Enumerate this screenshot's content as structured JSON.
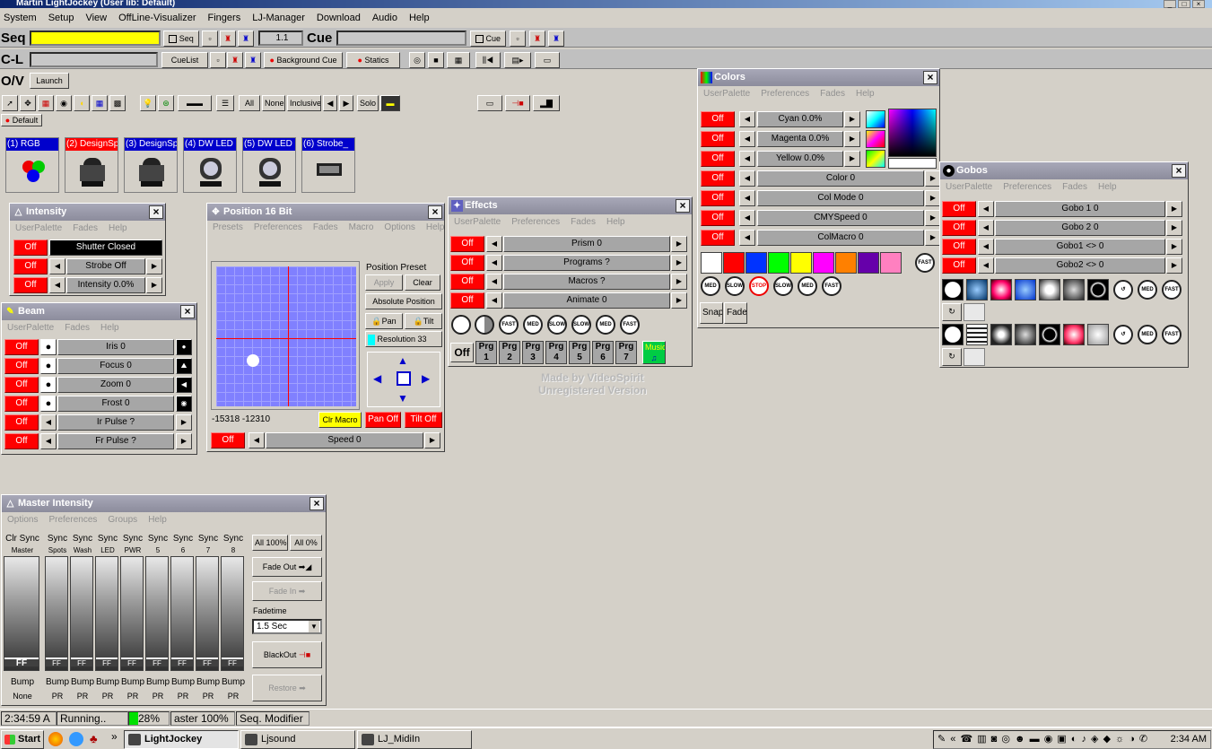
{
  "window": {
    "title": "Martin LightJockey (User lib: Default)"
  },
  "menu": [
    "System",
    "Setup",
    "View",
    "OffLine-Visualizer",
    "Fingers",
    "LJ-Manager",
    "Download",
    "Audio",
    "Help"
  ],
  "toolbar": {
    "seq_label": "Seq",
    "seq_btn": "Seq",
    "seq_counter": "1.1",
    "cue_label": "Cue",
    "cue_btn": "Cue",
    "cl_label": "C-L",
    "cuelist_btn": "CueList",
    "background_cue_btn": "Background Cue",
    "statics_btn": "Statics",
    "ov_label": "O/V",
    "launch_btn": "Launch",
    "all_btn": "All",
    "none_btn": "None",
    "inclusive_btn": "Inclusive",
    "solo_btn": "Solo",
    "default_tab": "Default"
  },
  "fixtures": [
    {
      "label": "(1) RGB",
      "color": "#0000cc",
      "icon": "rgb-dots-icon"
    },
    {
      "label": "(2) DesignSp",
      "color": "#ff0000",
      "icon": "moving-head-icon"
    },
    {
      "label": "(3) DesignSp",
      "color": "#0000cc",
      "icon": "moving-head-icon"
    },
    {
      "label": "(4) DW LED",
      "color": "#0000cc",
      "icon": "led-head-icon"
    },
    {
      "label": "(5) DW LED",
      "color": "#0000cc",
      "icon": "led-head-icon"
    },
    {
      "label": "(6) Strobe_",
      "color": "#0000cc",
      "icon": "strobe-icon"
    }
  ],
  "intensity": {
    "title": "Intensity",
    "menu": [
      "UserPalette",
      "Fades",
      "Help"
    ],
    "off": "Off",
    "shutter": "Shutter Closed",
    "strobe": "Strobe Off",
    "intensity": "Intensity 0.0%"
  },
  "beam": {
    "title": "Beam",
    "menu": [
      "UserPalette",
      "Fades",
      "Help"
    ],
    "off": "Off",
    "rows": [
      "Iris 0",
      "Focus 0",
      "Zoom 0",
      "Frost 0",
      "Ir Pulse ?",
      "Fr Pulse ?"
    ]
  },
  "position": {
    "title": "Position 16 Bit",
    "menu": [
      "Presets",
      "Preferences",
      "Fades",
      "Macro",
      "Options",
      "Help"
    ],
    "preset": "Position Preset",
    "apply": "Apply",
    "clear": "Clear",
    "absolute": "Absolute Position",
    "pan": "Pan",
    "tilt": "Tilt",
    "resolution": "Resolution 33",
    "coords": "-15318 -12310",
    "clr_macro": "Clr Macro",
    "pan_off": "Pan Off",
    "tilt_off": "Tilt Off",
    "off": "Off",
    "speed": "Speed 0"
  },
  "effects": {
    "title": "Effects",
    "menu": [
      "UserPalette",
      "Preferences",
      "Fades",
      "Help"
    ],
    "off": "Off",
    "rows": [
      "Prism 0",
      "Programs ?",
      "Macros ?",
      "Animate 0"
    ],
    "off_btn": "Off",
    "prg_label": "Prg",
    "prgs": [
      "1",
      "2",
      "3",
      "4",
      "5",
      "6",
      "7"
    ],
    "music": "Music"
  },
  "colors": {
    "title": "Colors",
    "menu": [
      "UserPalette",
      "Preferences",
      "Fades",
      "Help"
    ],
    "off": "Off",
    "rows": [
      "Cyan 0.0%",
      "Magenta 0.0%",
      "Yellow 0.0%",
      "Color 0",
      "Col Mode 0",
      "CMYSpeed 0",
      "ColMacro 0"
    ],
    "swatches": [
      "#ffffff",
      "#ff0000",
      "#0033ff",
      "#00ff00",
      "#ffff00",
      "#ff00ff",
      "#ff8000",
      "#6600aa",
      "#ff80c0"
    ],
    "snap": "Snap",
    "fade": "Fade",
    "speeds": [
      "MED",
      "SLOW",
      "STOP",
      "SLOW",
      "MED",
      "FAST"
    ],
    "fast": "FAST"
  },
  "gobos": {
    "title": "Gobos",
    "menu": [
      "UserPalette",
      "Preferences",
      "Fades",
      "Help"
    ],
    "off": "Off",
    "rows": [
      "Gobo 1 0",
      "Gobo 2 0",
      "Gobo1 <> 0",
      "Gobo2 <> 0"
    ],
    "speeds": [
      "MED",
      "FAST"
    ]
  },
  "master": {
    "title": "Master Intensity",
    "menu": [
      "Options",
      "Preferences",
      "Groups",
      "Help"
    ],
    "channels": [
      {
        "h": "Clr Sync",
        "sub": "Master",
        "pr": "None"
      },
      {
        "h": "Sync",
        "sub": "Spots",
        "pr": "PR"
      },
      {
        "h": "Sync",
        "sub": "Wash",
        "pr": "PR"
      },
      {
        "h": "Sync",
        "sub": "LED",
        "pr": "PR"
      },
      {
        "h": "Sync",
        "sub": "PWR",
        "pr": "PR"
      },
      {
        "h": "Sync",
        "sub": "5",
        "pr": "PR"
      },
      {
        "h": "Sync",
        "sub": "6",
        "pr": "PR"
      },
      {
        "h": "Sync",
        "sub": "7",
        "pr": "PR"
      },
      {
        "h": "Sync",
        "sub": "8",
        "pr": "PR"
      }
    ],
    "ff": "FF",
    "bump": "Bump",
    "all100": "All 100%",
    "all0": "All 0%",
    "fade_out": "Fade Out",
    "fade_in": "Fade In",
    "fadetime_label": "Fadetime",
    "fadetime": "1.5 Sec",
    "blackout": "BlackOut",
    "restore": "Restore"
  },
  "status": {
    "time": "2:34:59 A",
    "state": "Running..",
    "percent": "28%",
    "master": "aster  100%",
    "modifier": "Seq. Modifier"
  },
  "watermark": {
    "line1": "Made by VideoSpirit",
    "line2": "Unregistered Version"
  },
  "taskbar": {
    "start": "Start",
    "tasks": [
      "LightJockey",
      "Ljsound",
      "LJ_MidiIn"
    ],
    "clock": "2:34 AM"
  }
}
